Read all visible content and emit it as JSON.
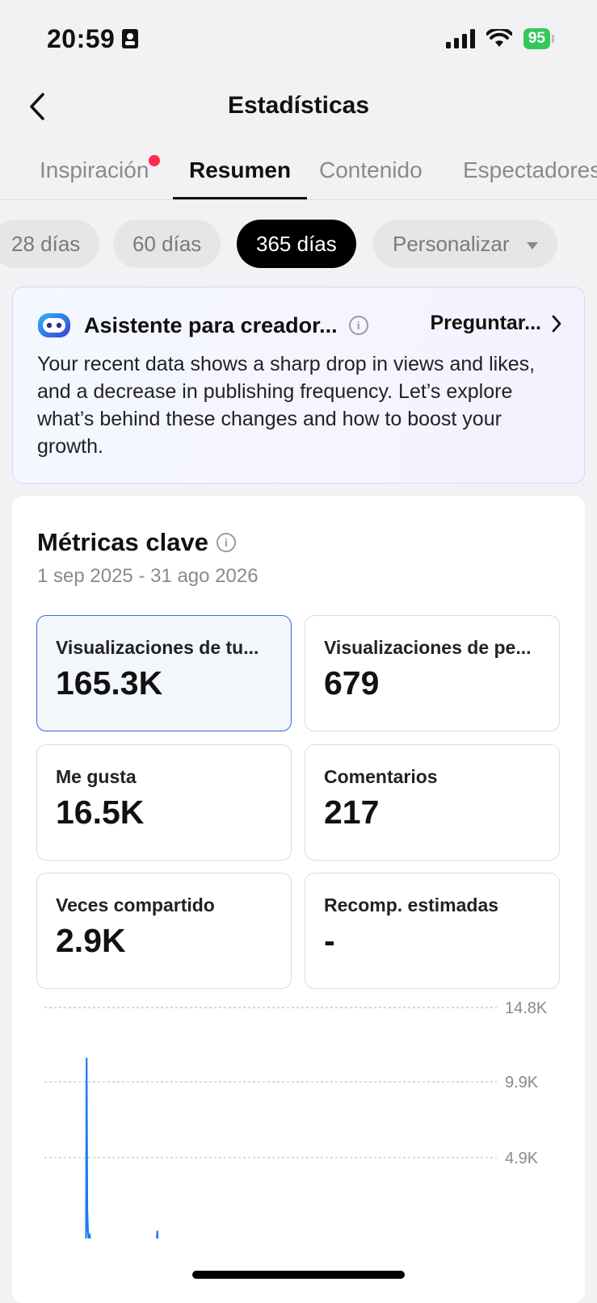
{
  "status_bar": {
    "time": "20:59",
    "battery": "95"
  },
  "nav": {
    "title": "Estadísticas"
  },
  "tabs": [
    {
      "label": "Inspiración",
      "has_dot": true
    },
    {
      "label": "Resumen",
      "active": true
    },
    {
      "label": "Contenido"
    },
    {
      "label": "Espectadores"
    }
  ],
  "chips": [
    {
      "label": "28 días"
    },
    {
      "label": "60 días"
    },
    {
      "label": "365 días",
      "active": true
    },
    {
      "label": "Personalizar"
    }
  ],
  "assistant": {
    "title": "Asistente para creador...",
    "ask": "Preguntar...",
    "body": "Your recent data shows a sharp drop in views and likes, and a decrease in publishing frequency. Let’s explore what’s behind these changes and how to boost your growth."
  },
  "metrics": {
    "title": "Métricas clave",
    "range": "1 sep 2025 - 31 ago 2026",
    "tiles": [
      {
        "label": "Visualizaciones de tu...",
        "value": "165.3K",
        "selected": true
      },
      {
        "label": "Visualizaciones de pe...",
        "value": "679"
      },
      {
        "label": "Me gusta",
        "value": "16.5K"
      },
      {
        "label": "Comentarios",
        "value": "217"
      },
      {
        "label": "Veces compartido",
        "value": "2.9K"
      },
      {
        "label": "Recomp. estimadas",
        "value": "-"
      }
    ]
  },
  "chart_data": {
    "type": "line",
    "y_tick_labels": [
      "14.8K",
      "9.9K",
      "4.9K"
    ],
    "y_ticks": [
      14800,
      9900,
      4900
    ],
    "ylim": [
      0,
      14800
    ],
    "x_range_days": [
      0,
      365
    ],
    "grid": "horizontal dashed",
    "series_color": "#1a7cf0",
    "points": [
      [
        0,
        0
      ],
      [
        38,
        0
      ],
      [
        41,
        400
      ],
      [
        42,
        12500
      ],
      [
        43,
        2600
      ],
      [
        44,
        1200
      ],
      [
        46,
        300
      ],
      [
        47,
        900
      ],
      [
        48,
        400
      ],
      [
        50,
        200
      ],
      [
        52,
        500
      ],
      [
        53,
        200
      ],
      [
        55,
        100
      ],
      [
        60,
        0
      ],
      [
        150,
        0
      ],
      [
        155,
        200
      ],
      [
        156,
        1100
      ],
      [
        157,
        300
      ],
      [
        160,
        0
      ],
      [
        365,
        0
      ]
    ]
  },
  "colors": {
    "accent": "#1a7cf0",
    "tab_dot": "#fe2c55",
    "battery": "#34c759"
  }
}
